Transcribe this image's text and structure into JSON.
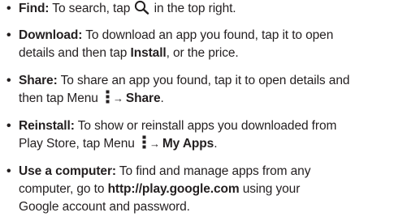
{
  "items": [
    {
      "label": "Find:",
      "lines": [
        {
          "t1": " To search, tap ",
          "icon": "search-icon",
          "t2": " in the top right."
        }
      ]
    },
    {
      "label": "Download:",
      "text_1": " To download an app you found, tap it to open",
      "text_2": "details and then tap ",
      "bold_2": "Install",
      "text_3": ", or the price."
    },
    {
      "label": "Share:",
      "text_1": " To share an app you found, tap it to open details and",
      "text_2": "then tap Menu ",
      "icon": "menu-icon",
      "arrow": "→",
      "bold_2": "Share",
      "text_3": "."
    },
    {
      "label": "Reinstall:",
      "text_1": " To show or reinstall apps you downloaded from",
      "text_2": "Play Store, tap Menu ",
      "icon": "menu-icon",
      "arrow": "→",
      "bold_2": "My Apps",
      "text_3": "."
    },
    {
      "label": "Use a computer:",
      "text_1": " To find and manage apps from any",
      "text_2": "computer, go to ",
      "bold_2": "http://play.google.com",
      "text_3": " using your",
      "text_4": "Google account and password."
    }
  ],
  "bullet_char": "•"
}
